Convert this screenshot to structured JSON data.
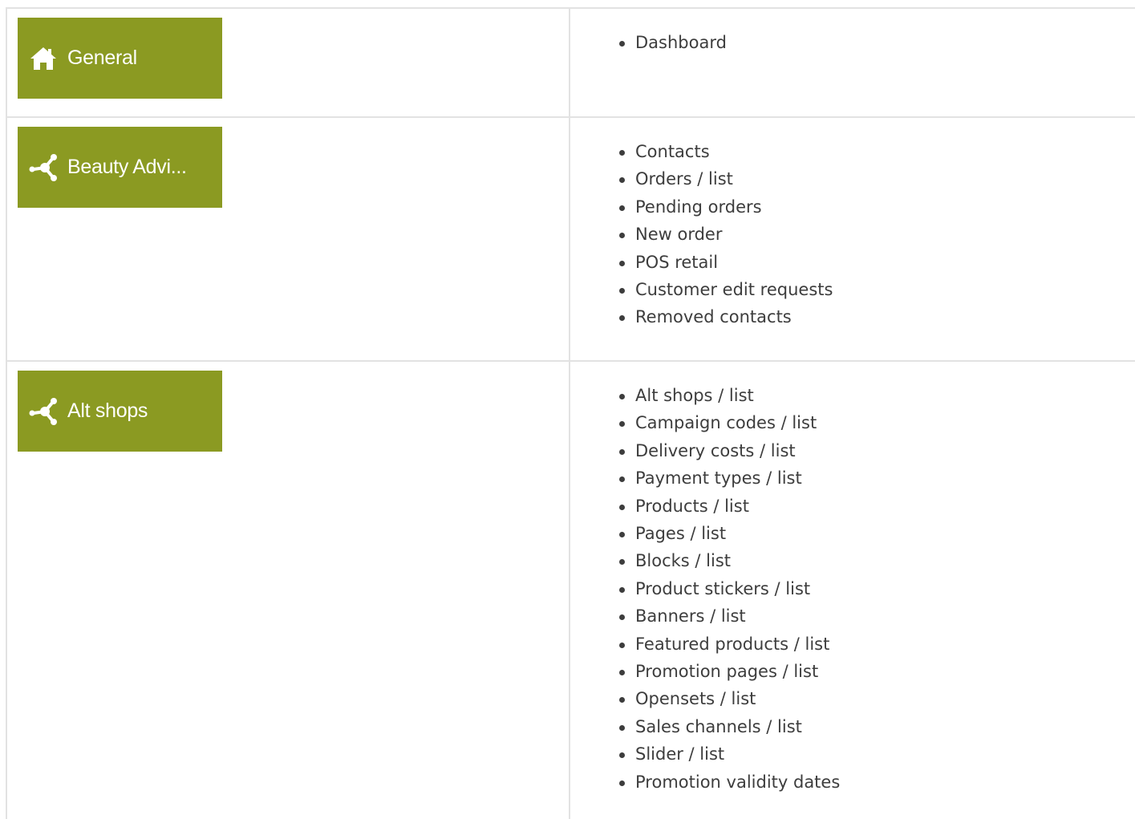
{
  "sections": [
    {
      "title": "General",
      "icon": "home-icon",
      "items": [
        "Dashboard"
      ]
    },
    {
      "title": "Beauty Advi...",
      "icon": "share-network-icon",
      "items": [
        "Contacts",
        "Orders / list",
        "Pending orders",
        "New order",
        "POS retail",
        "Customer edit requests",
        "Removed contacts"
      ]
    },
    {
      "title": "Alt shops",
      "icon": "share-network-icon",
      "items": [
        "Alt shops / list",
        "Campaign codes / list",
        "Delivery costs / list",
        "Payment types / list",
        "Products / list",
        "Pages / list",
        "Blocks / list",
        "Product stickers / list",
        "Banners / list",
        "Featured products / list",
        "Promotion pages / list",
        "Opensets / list",
        "Sales channels / list",
        "Slider / list",
        "Promotion validity dates"
      ]
    }
  ],
  "colors": {
    "tile_background": "#8b9a22",
    "tile_text": "#ffffff",
    "border": "#e2e2e2",
    "text": "#3d3d3d"
  }
}
